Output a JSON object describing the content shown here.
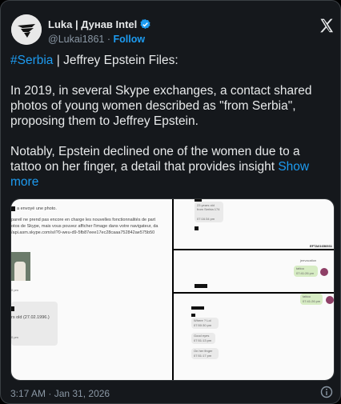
{
  "author": {
    "name": "Luka | Дунав Intel",
    "handle": "@Lukai1861",
    "separator": "·",
    "follow_label": "Follow"
  },
  "tweet": {
    "hashtag": "#Serbia",
    "line1_rest": " | Jeffrey Epstein Files:",
    "para2": "In 2019, in several Skype exchanges, a contact shared photos of young women described as \"from Serbia\", proposing them to Jeffrey Epstein.",
    "para3": "Notably, Epstein declined one of the women due to a tattoo on her finger, a detail that provides insight ",
    "show_more": "Show more",
    "timestamp": "3:17 AM · Jan 31, 2026"
  },
  "media": {
    "left": {
      "line1": "a envoyé une photo.",
      "line2": "pareil ne prend pas encore en charge les nouvelles fonctionnalités de part",
      "line3": "otos de Skype, mais vous pouvez afficher l'image dans votre navigateur, da",
      "line4": "/api.asm.skype.com/s/i?0-weu-d9-5fb87eee17ec28caaa752842ae575b50",
      "pm1": "0 pm",
      "age": "rs old (27.02.1996.)",
      "pm2": "0 pm"
    },
    "right_top": {
      "msg": "23 years old from Serbia 174",
      "time": "07:16:34 pm",
      "doc_id": "EFTA01656931"
    },
    "right_mid": {
      "sender": "jeevacation",
      "msg": "tattoo",
      "time": "07:41:26 pm"
    },
    "right_bottom": {
      "green": "tattoo",
      "green_time": "07:41:26 pm",
      "m1": "Where ? Lol",
      "t1": "07:50:30 pm",
      "m2": "Good eyes",
      "t2": "07:51:13 pm",
      "m3": "On her finger",
      "t3": "07:51:17 pm"
    }
  },
  "colors": {
    "background": "#15181c",
    "text": "#e7e9ea",
    "muted": "#8b98a5",
    "accent": "#1d9bf0"
  },
  "icons": [
    "avatar-logo-icon",
    "verified-badge-icon",
    "x-logo-icon",
    "info-icon"
  ]
}
